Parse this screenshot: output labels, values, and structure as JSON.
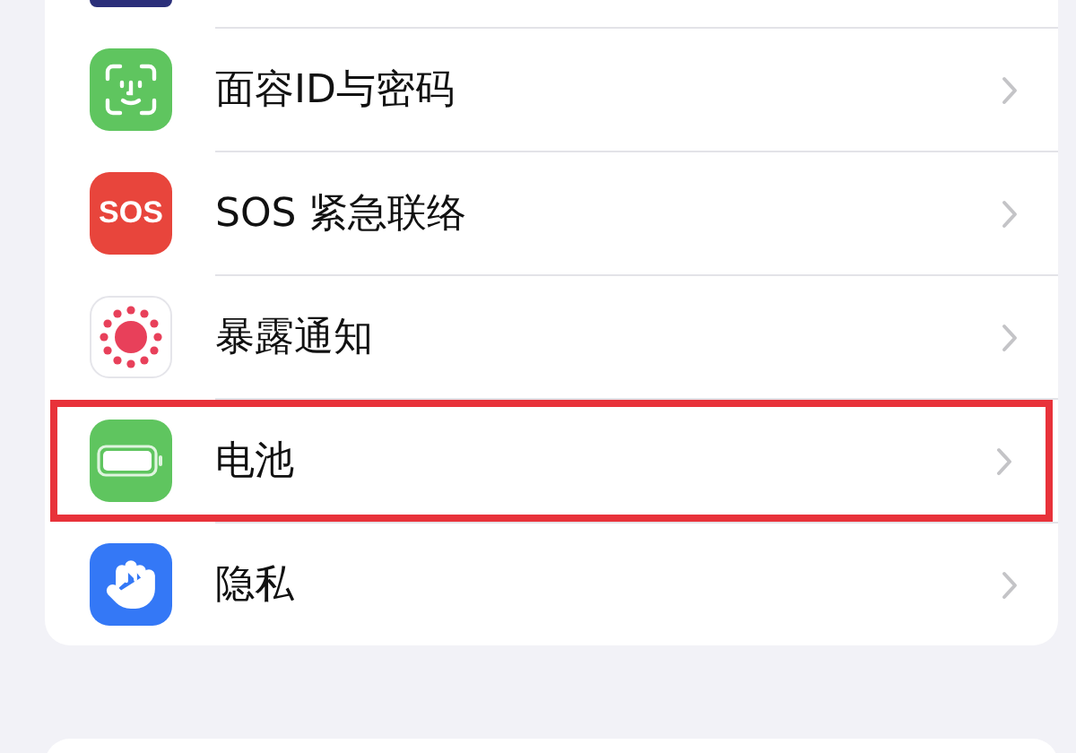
{
  "settings_group": {
    "rows": [
      {
        "kind": "face-id",
        "label": "面容ID与密码",
        "highlighted": false
      },
      {
        "kind": "sos",
        "icon_text": "SOS",
        "label": "SOS 紧急联络",
        "highlighted": false
      },
      {
        "kind": "exposure",
        "label": "暴露通知",
        "highlighted": false
      },
      {
        "kind": "battery",
        "label": "电池",
        "highlighted": true
      },
      {
        "kind": "privacy",
        "label": "隐私",
        "highlighted": false
      }
    ]
  }
}
